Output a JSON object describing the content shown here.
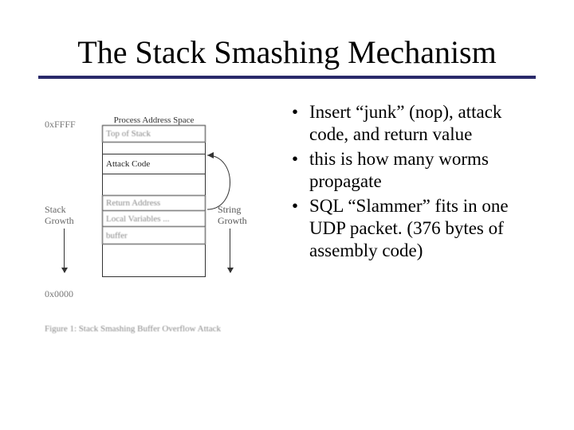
{
  "title": "The Stack Smashing Mechanism",
  "bullets": [
    "Insert “junk” (nop), attack code, and return value",
    "this is how many worms propagate",
    "SQL “Slammer” fits in one UDP packet. (376 bytes of assembly code)"
  ],
  "figure": {
    "header": "Process Address Space",
    "addr_top": "0xFFFF",
    "addr_bottom": "0x0000",
    "rows": {
      "top_of_stack": "Top of Stack",
      "attack_code": "Attack Code",
      "return_address": "Return Address",
      "local_vars": "Local Variables ...",
      "buffer": "buffer"
    },
    "left_label": "Stack\nGrowth",
    "right_label": "String\nGrowth",
    "caption": "Figure 1: Stack Smashing Buffer Overflow Attack"
  }
}
